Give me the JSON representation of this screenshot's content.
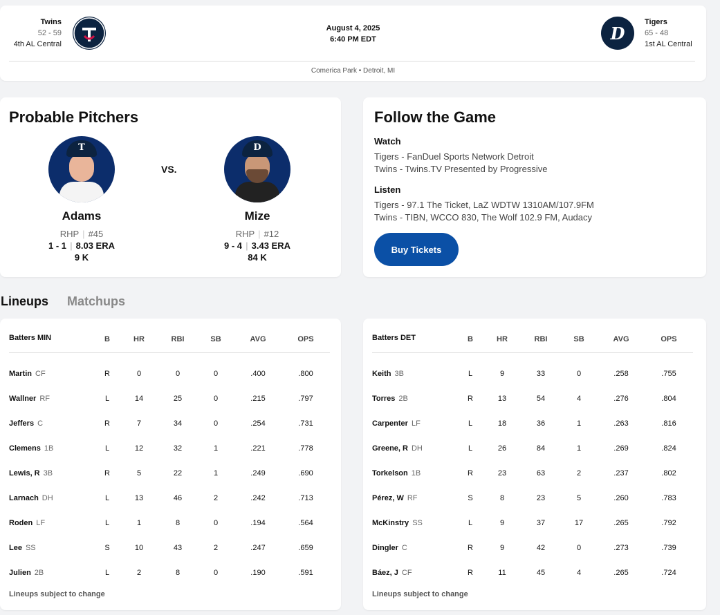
{
  "game": {
    "away": {
      "name": "Twins",
      "record": "52 - 59",
      "standing": "4th AL Central",
      "logo_icon": "twins-logo-icon",
      "logo_text": "TC"
    },
    "home": {
      "name": "Tigers",
      "record": "65 - 48",
      "standing": "1st AL Central",
      "logo_icon": "tigers-logo-icon",
      "logo_text": "D"
    },
    "date": "August 4, 2025",
    "time": "6:40 PM EDT",
    "venue": "Comerica Park • Detroit, MI"
  },
  "pitchers": {
    "title": "Probable Pitchers",
    "vs": "VS.",
    "away": {
      "name": "Adams",
      "hand": "RHP",
      "number": "#45",
      "record": "1 - 1",
      "era": "8.03 ERA",
      "k": "9 K",
      "cap_text": "T"
    },
    "home": {
      "name": "Mize",
      "hand": "RHP",
      "number": "#12",
      "record": "9 - 4",
      "era": "3.43 ERA",
      "k": "84 K",
      "cap_text": "D"
    }
  },
  "follow": {
    "title": "Follow the Game",
    "watch_label": "Watch",
    "watch": [
      "Tigers - FanDuel Sports Network Detroit",
      "Twins - Twins.TV Presented by Progressive"
    ],
    "listen_label": "Listen",
    "listen": [
      "Tigers - 97.1 The Ticket, LaZ WDTW 1310AM/107.9FM",
      "Twins - TIBN, WCCO 830, The Wolf 102.9 FM, Audacy"
    ],
    "buy_label": "Buy Tickets"
  },
  "tabs": {
    "lineups": "Lineups",
    "matchups": "Matchups"
  },
  "columns": [
    "B",
    "HR",
    "RBI",
    "SB",
    "AVG",
    "OPS"
  ],
  "lineups": {
    "min": {
      "header": "Batters MIN",
      "rows": [
        {
          "name": "Martin",
          "pos": "CF",
          "b": "R",
          "hr": "0",
          "rbi": "0",
          "sb": "0",
          "avg": ".400",
          "ops": ".800"
        },
        {
          "name": "Wallner",
          "pos": "RF",
          "b": "L",
          "hr": "14",
          "rbi": "25",
          "sb": "0",
          "avg": ".215",
          "ops": ".797"
        },
        {
          "name": "Jeffers",
          "pos": "C",
          "b": "R",
          "hr": "7",
          "rbi": "34",
          "sb": "0",
          "avg": ".254",
          "ops": ".731"
        },
        {
          "name": "Clemens",
          "pos": "1B",
          "b": "L",
          "hr": "12",
          "rbi": "32",
          "sb": "1",
          "avg": ".221",
          "ops": ".778"
        },
        {
          "name": "Lewis, R",
          "pos": "3B",
          "b": "R",
          "hr": "5",
          "rbi": "22",
          "sb": "1",
          "avg": ".249",
          "ops": ".690"
        },
        {
          "name": "Larnach",
          "pos": "DH",
          "b": "L",
          "hr": "13",
          "rbi": "46",
          "sb": "2",
          "avg": ".242",
          "ops": ".713"
        },
        {
          "name": "Roden",
          "pos": "LF",
          "b": "L",
          "hr": "1",
          "rbi": "8",
          "sb": "0",
          "avg": ".194",
          "ops": ".564"
        },
        {
          "name": "Lee",
          "pos": "SS",
          "b": "S",
          "hr": "10",
          "rbi": "43",
          "sb": "2",
          "avg": ".247",
          "ops": ".659"
        },
        {
          "name": "Julien",
          "pos": "2B",
          "b": "L",
          "hr": "2",
          "rbi": "8",
          "sb": "0",
          "avg": ".190",
          "ops": ".591"
        }
      ],
      "footnote": "Lineups subject to change"
    },
    "det": {
      "header": "Batters DET",
      "rows": [
        {
          "name": "Keith",
          "pos": "3B",
          "b": "L",
          "hr": "9",
          "rbi": "33",
          "sb": "0",
          "avg": ".258",
          "ops": ".755"
        },
        {
          "name": "Torres",
          "pos": "2B",
          "b": "R",
          "hr": "13",
          "rbi": "54",
          "sb": "4",
          "avg": ".276",
          "ops": ".804"
        },
        {
          "name": "Carpenter",
          "pos": "LF",
          "b": "L",
          "hr": "18",
          "rbi": "36",
          "sb": "1",
          "avg": ".263",
          "ops": ".816"
        },
        {
          "name": "Greene, R",
          "pos": "DH",
          "b": "L",
          "hr": "26",
          "rbi": "84",
          "sb": "1",
          "avg": ".269",
          "ops": ".824"
        },
        {
          "name": "Torkelson",
          "pos": "1B",
          "b": "R",
          "hr": "23",
          "rbi": "63",
          "sb": "2",
          "avg": ".237",
          "ops": ".802"
        },
        {
          "name": "Pérez, W",
          "pos": "RF",
          "b": "S",
          "hr": "8",
          "rbi": "23",
          "sb": "5",
          "avg": ".260",
          "ops": ".783"
        },
        {
          "name": "McKinstry",
          "pos": "SS",
          "b": "L",
          "hr": "9",
          "rbi": "37",
          "sb": "17",
          "avg": ".265",
          "ops": ".792"
        },
        {
          "name": "Dingler",
          "pos": "C",
          "b": "R",
          "hr": "9",
          "rbi": "42",
          "sb": "0",
          "avg": ".273",
          "ops": ".739"
        },
        {
          "name": "Báez, J",
          "pos": "CF",
          "b": "R",
          "hr": "11",
          "rbi": "45",
          "sb": "4",
          "avg": ".265",
          "ops": ".724"
        }
      ],
      "footnote": "Lineups subject to change"
    }
  },
  "colors": {
    "accent": "#0b50a6",
    "navy": "#0c2340",
    "twins_red": "#d31145"
  }
}
